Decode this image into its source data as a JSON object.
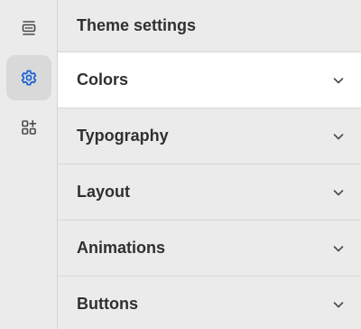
{
  "rail": {
    "items": [
      {
        "icon": "sections-icon",
        "active": false
      },
      {
        "icon": "gear-icon",
        "active": true
      },
      {
        "icon": "apps-add-icon",
        "active": false
      }
    ]
  },
  "panel": {
    "title": "Theme settings",
    "sections": [
      {
        "label": "Colors",
        "active": true
      },
      {
        "label": "Typography",
        "active": false
      },
      {
        "label": "Layout",
        "active": false
      },
      {
        "label": "Animations",
        "active": false
      },
      {
        "label": "Buttons",
        "active": false
      }
    ]
  },
  "colors": {
    "accent": "#1a5fd6",
    "icon": "#4a4a4a",
    "text": "#303030",
    "active_bg": "#ffffff",
    "background": "#ebebeb"
  }
}
